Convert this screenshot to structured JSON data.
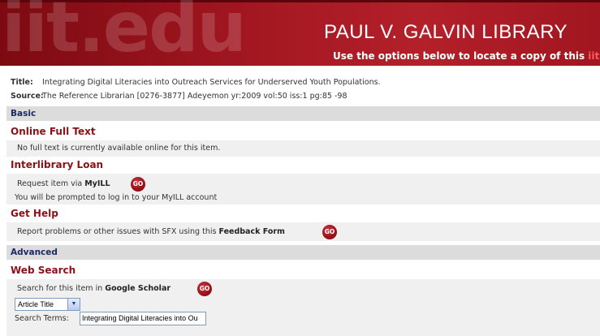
{
  "banner": {
    "ghost_text": "iit.edu",
    "library_name": "PAUL V. GALVIN LIBRARY",
    "tagline_prefix": "Use the options below to locate a copy of this ",
    "tagline_highlight": "iit"
  },
  "citation": {
    "title_label": "Title:",
    "title_value": "Integrating Digital Literacies into Outreach Services for Underserved Youth Populations.",
    "source_label": "Source:",
    "source_value": "The Reference Librarian [0276-3877] Adeyemon yr:2009 vol:50 iss:1 pg:85 -98"
  },
  "sections": {
    "basic": "Basic",
    "advanced": "Advanced"
  },
  "online_full_text": {
    "heading": "Online Full Text",
    "message": "No full text is currently available online for this item."
  },
  "interlibrary_loan": {
    "heading": "Interlibrary Loan",
    "request_prefix": "Request item via ",
    "request_service": "MyILL",
    "go_label": "GO",
    "note": "You will be prompted to log in to your MyILL account"
  },
  "get_help": {
    "heading": "Get Help",
    "report_prefix": "Report problems or other issues with SFX using this ",
    "report_link": "Feedback Form",
    "go_label": "GO"
  },
  "web_search": {
    "heading": "Web Search",
    "search_prefix": "Search for this item in ",
    "search_engine": "Google Scholar",
    "go_label": "GO",
    "field_select_value": "Article Title",
    "terms_label": "Search Terms:",
    "terms_value": "Integrating Digital Literacies into Ou"
  },
  "colors": {
    "banner": "#a51822",
    "heading": "#8c1018",
    "section_text": "#1a2a66",
    "panel": "#f0f0f0"
  }
}
